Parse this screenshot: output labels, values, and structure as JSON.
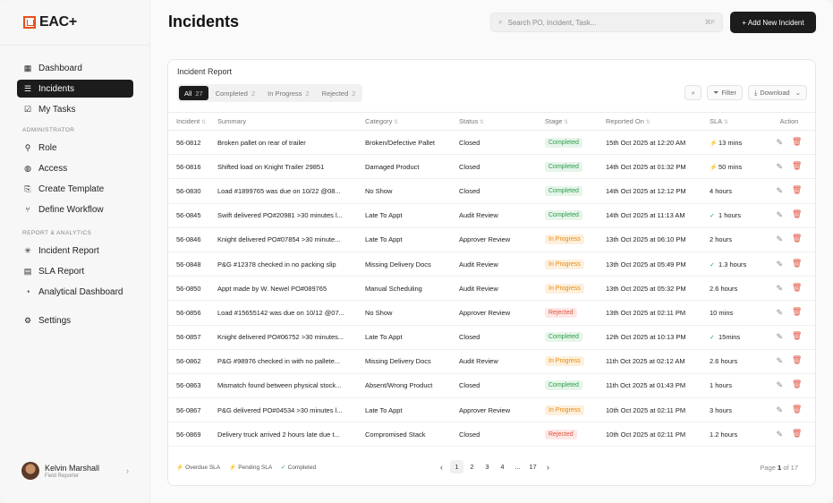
{
  "app": {
    "logo_text": "EAC+",
    "brand_color": "#e8501e"
  },
  "sidebar": {
    "items_main": [
      {
        "label": "Dashboard",
        "icon": "grid-icon",
        "active": false
      },
      {
        "label": "Incidents",
        "icon": "list-icon",
        "active": true
      },
      {
        "label": "My Tasks",
        "icon": "tasks-icon",
        "active": false
      }
    ],
    "section_admin": "ADMINISTRATOR",
    "items_admin": [
      {
        "label": "Role",
        "icon": "role-icon"
      },
      {
        "label": "Access",
        "icon": "access-icon"
      },
      {
        "label": "Create Template",
        "icon": "template-icon"
      },
      {
        "label": "Define Workflow",
        "icon": "workflow-icon"
      }
    ],
    "section_report": "REPORT & ANALYTICS",
    "items_report": [
      {
        "label": "Incident Report",
        "icon": "asterisk-icon"
      },
      {
        "label": "SLA Report",
        "icon": "report-icon"
      },
      {
        "label": "Analytical Dashboard",
        "icon": "chart-icon"
      }
    ],
    "settings_label": "Settings",
    "user": {
      "name": "Kelvin Marshall",
      "role": "Field Reporter"
    }
  },
  "header": {
    "title": "Incidents",
    "search_placeholder": "Search PO, Incident, Task...",
    "search_shortcut": "⌘F",
    "new_button": "+ Add New Incident"
  },
  "report": {
    "title": "Incident Report",
    "tabs": [
      {
        "label": "All",
        "count": "27",
        "active": true
      },
      {
        "label": "Completed",
        "count": "2",
        "active": false
      },
      {
        "label": "In Progress",
        "count": "2",
        "active": false
      },
      {
        "label": "Rejected",
        "count": "2",
        "active": false
      }
    ],
    "filter_label": "Filter",
    "download_label": "Download",
    "columns": [
      "Incident",
      "Summary",
      "Category",
      "Status",
      "Stage",
      "Reported On",
      "SLA",
      "Action"
    ],
    "rows": [
      {
        "id": "56-0812",
        "summary": "Broken pallet on rear of trailer",
        "category": "Broken/Defective Pallet",
        "status": "Closed",
        "stage": "Completed",
        "reported": "15th Oct 2025 at 12:20 AM",
        "sla": "13 mins",
        "sla_flag": "overdue"
      },
      {
        "id": "56-0816",
        "summary": "Shifted load on Knight Trailer 29851",
        "category": "Damaged Product",
        "status": "Closed",
        "stage": "Completed",
        "reported": "14th Oct 2025 at 01:32 PM",
        "sla": "50 mins",
        "sla_flag": "pending"
      },
      {
        "id": "56-0830",
        "summary": "Load #1899765 was due on 10/22 @08...",
        "category": "No Show",
        "status": "Closed",
        "stage": "Completed",
        "reported": "14th Oct 2025 at 12:12 PM",
        "sla": "4 hours",
        "sla_flag": ""
      },
      {
        "id": "56-0845",
        "summary": "Swift delivered PO#20981 >30 minutes l...",
        "category": "Late To Appt",
        "status": "Audit Review",
        "stage": "Completed",
        "reported": "14th Oct 2025 at 11:13 AM",
        "sla": "1 hours",
        "sla_flag": "completed"
      },
      {
        "id": "56-0846",
        "summary": "Knight delivered PO#07854 >30 minute...",
        "category": "Late To Appt",
        "status": "Approver Review",
        "stage": "In Progress",
        "reported": "13th Oct 2025 at 06:10 PM",
        "sla": "2 hours",
        "sla_flag": ""
      },
      {
        "id": "56-0848",
        "summary": "P&G #12378 checked in no packing slip",
        "category": "Missing Delivery Docs",
        "status": "Audit Review",
        "stage": "In Progress",
        "reported": "13th Oct 2025 at 05:49 PM",
        "sla": "1.3 hours",
        "sla_flag": "completed"
      },
      {
        "id": "56-0850",
        "summary": "Appt made by W. Newel PO#089765",
        "category": "Manual Scheduling",
        "status": "Audit Review",
        "stage": "In Progress",
        "reported": "13th Oct 2025 at 05:32 PM",
        "sla": "2.6 hours",
        "sla_flag": ""
      },
      {
        "id": "56-0856",
        "summary": "Load #15655142 was due on 10/12 @07...",
        "category": "No Show",
        "status": "Approver Review",
        "stage": "Rejected",
        "reported": "13th Oct 2025 at 02:11 PM",
        "sla": "10 mins",
        "sla_flag": ""
      },
      {
        "id": "56-0857",
        "summary": "Knight delivered PO#06752 >30 minutes...",
        "category": "Late To Appt",
        "status": "Closed",
        "stage": "Completed",
        "reported": "12th Oct 2025 at 10:13 PM",
        "sla": "15mins",
        "sla_flag": "completed"
      },
      {
        "id": "56-0862",
        "summary": "P&G #98976 checked in with no pallete...",
        "category": "Missing Delivery Docs",
        "status": "Audit Review",
        "stage": "In Progress",
        "reported": "11th Oct 2025 at 02:12 AM",
        "sla": "2.6 hours",
        "sla_flag": ""
      },
      {
        "id": "56-0863",
        "summary": "Mismatch found between physical stock...",
        "category": "Absent/Wrong Product",
        "status": "Closed",
        "stage": "Completed",
        "reported": "11th Oct 2025 at 01:43 PM",
        "sla": "1 hours",
        "sla_flag": ""
      },
      {
        "id": "56-0867",
        "summary": "P&G delivered PO#04534 >30 minutes l...",
        "category": "Late To Appt",
        "status": "Approver Review",
        "stage": "In Progress",
        "reported": "10th Oct 2025 at 02:11 PM",
        "sla": "3 hours",
        "sla_flag": ""
      },
      {
        "id": "56-0869",
        "summary": "Delivery truck arrived 2 hours late due t...",
        "category": "Compromised Stack",
        "status": "Closed",
        "stage": "Rejected",
        "reported": "10th Oct 2025 at 02:11 PM",
        "sla": "1.2 hours",
        "sla_flag": ""
      }
    ],
    "legend": {
      "overdue": "Overdue SLA",
      "pending": "Pending SLA",
      "completed": "Completed"
    },
    "pages": [
      "1",
      "2",
      "3",
      "4",
      "...",
      "17"
    ],
    "page_info_prefix": "Page",
    "page_current": "1",
    "page_info_suffix": "of 17",
    "colors": {
      "overdue": "#e0503d",
      "pending": "#5a5ae0",
      "completed": "#2c9b4a"
    }
  }
}
